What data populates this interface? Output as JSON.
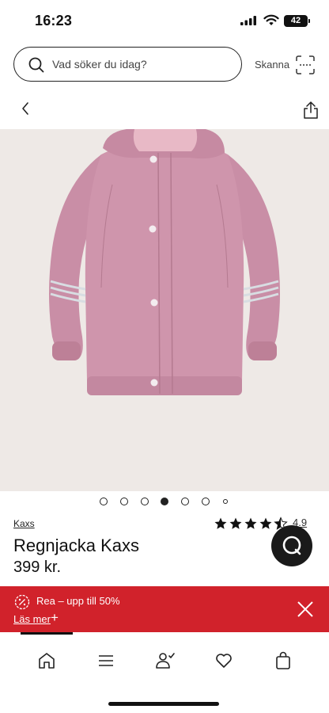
{
  "status": {
    "time": "16:23",
    "battery": "42"
  },
  "search": {
    "placeholder": "Vad söker du idag?",
    "scan_label": "Skanna"
  },
  "gallery": {
    "image_count": 7,
    "active_index": 3
  },
  "product": {
    "brand": "Kaxs",
    "title": "Regnjacka Kaxs",
    "price": "399 kr.",
    "rating": "4.9",
    "rating_stars": 4.5,
    "image_color": "#c98ea6"
  },
  "promo": {
    "text": "Rea – upp till 50%",
    "link": "Läs mer",
    "color": "#d1222b"
  },
  "nav": {
    "items": [
      "home-icon",
      "menu-icon",
      "account-icon",
      "heart-icon",
      "bag-icon"
    ]
  }
}
